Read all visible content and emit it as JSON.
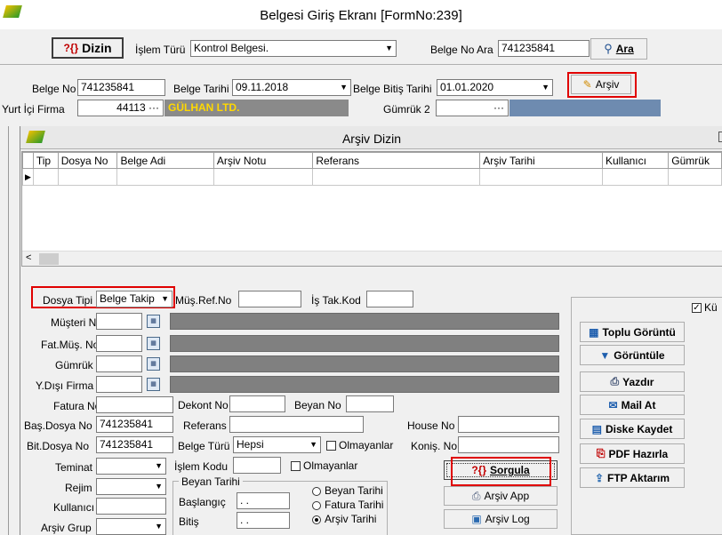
{
  "main_window": {
    "title": "Belgesi Giriş Ekranı [FormNo:239]",
    "dizin_label": "Dizin",
    "islem_turu_label": "İşlem Türü",
    "islem_turu_value": "Kontrol Belgesi.",
    "belge_no_ara_label": "Belge No Ara",
    "belge_no_ara_value": "741235841",
    "ara_label": "Ara",
    "belge_no_label": "Belge No",
    "belge_no_value": "741235841",
    "belge_tarihi_label": "Belge Tarihi",
    "belge_tarihi_value": "09.11.2018",
    "belge_bitis_label": "Belge Bitiş Tarihi",
    "belge_bitis_value": "01.01.2020",
    "arsiv_label": "Arşiv",
    "yurt_ici_label": "Yurt İçi Firma",
    "yurt_ici_code": "44113",
    "yurt_ici_name": "GÜLHAN LTD.",
    "gumruk2_label": "Gümrük 2"
  },
  "arsiv_dizin": {
    "title": "Arşiv Dizin",
    "columns": [
      "Tip",
      "Dosya No",
      "Belge Adi",
      "Arşiv Notu",
      "Referans",
      "Arşiv Tarihi",
      "Kullanıcı",
      "Gümrük"
    ],
    "form": {
      "dosya_tipi_label": "Dosya Tipi",
      "dosya_tipi_value": "Belge Takip",
      "mus_ref_label": "Müş.Ref.No",
      "is_takip_label": "İş Tak.Kod",
      "musteri_no_label": "Müşteri No",
      "fat_mus_label": "Fat.Müş. No",
      "gumruk_label": "Gümrük",
      "ydisi_label": "Y.Dışı Firma",
      "fatura_no_label": "Fatura No",
      "dekont_no_label": "Dekont No",
      "beyan_no_label": "Beyan No",
      "bas_dosya_label": "Baş.Dosya No",
      "bas_dosya_value": "741235841",
      "referans_label": "Referans",
      "house_no_label": "House No",
      "bit_dosya_label": "Bit.Dosya No",
      "bit_dosya_value": "741235841",
      "belge_turu_label": "Belge Türü",
      "belge_turu_value": "Hepsi",
      "olmayanlar1": "Olmayanlar",
      "konis_label": "Koniş. No",
      "teminat_label": "Teminat",
      "islem_kodu_label": "İşlem Kodu",
      "olmayanlar2": "Olmayanlar",
      "rejim_label": "Rejim",
      "kullanici_label": "Kullanıcı",
      "arsiv_grup_label": "Arşiv Grup",
      "beyan_tarihi_group": "Beyan Tarihi",
      "baslangic_label": "Başlangıç",
      "bitis_label": "Bitiş",
      "date_placeholder": ". .",
      "radio_beyan": "Beyan Tarihi",
      "radio_fatura": "Fatura Tarihi",
      "radio_arsiv": "Arşiv Tarihi",
      "sorgula_label": "Sorgula",
      "arsiv_app_label": "Arşiv App",
      "arsiv_log_label": "Arşiv Log",
      "ku_label": "Kü"
    },
    "actions": [
      "Toplu Görüntü",
      "Görüntüle",
      "Yazdır",
      "Mail At",
      "Diske Kaydet",
      "PDF Hazırla",
      "FTP Aktarım"
    ]
  }
}
